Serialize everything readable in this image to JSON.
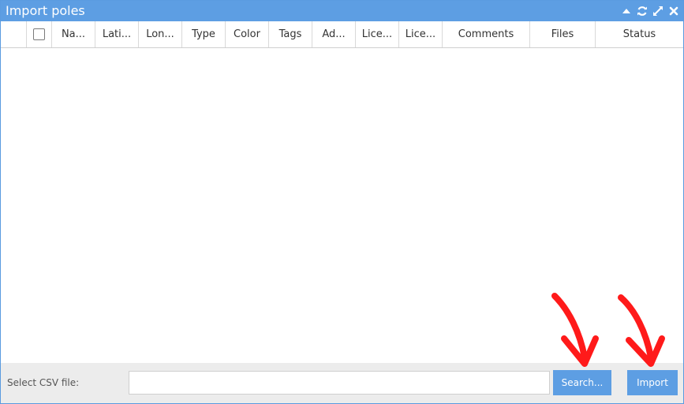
{
  "window": {
    "title": "Import poles",
    "tools": [
      "collapse-icon",
      "refresh-icon",
      "maximize-icon",
      "close-icon"
    ]
  },
  "grid": {
    "columns": [
      "Na...",
      "Lati...",
      "Lon...",
      "Type",
      "Color",
      "Tags",
      "Ad...",
      "Lice...",
      "Lice...",
      "Comments",
      "Files",
      "Status"
    ]
  },
  "footer": {
    "label": "Select CSV file:",
    "file_value": "",
    "search_label": "Search...",
    "import_label": "Import"
  },
  "colors": {
    "accent": "#5d9ee3",
    "annotation_arrow": "#ff1a1a"
  }
}
